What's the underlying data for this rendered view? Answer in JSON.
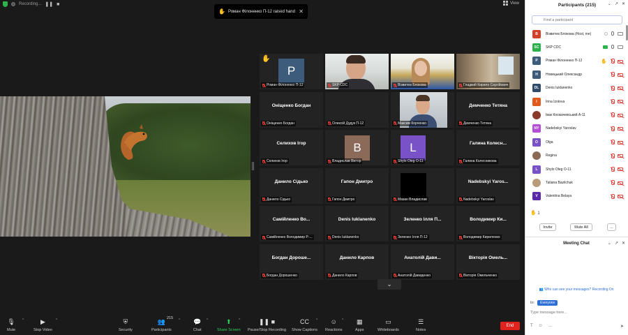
{
  "topbar": {
    "recording_label": "Recording...",
    "view_label": "View"
  },
  "notification": {
    "text": "Роман Філоненко П-12 raised hand"
  },
  "gallery": {
    "tiles": [
      {
        "label": "Роман Філоненко П-12",
        "avatar": "P",
        "avatar_color": "#3d5b7a",
        "hand": true
      },
      {
        "label": "SKP CDC",
        "video": "man-room",
        "highlight": true
      },
      {
        "label": "Візвитев Блокова",
        "video": "woman-flag"
      },
      {
        "label": "Гладкий Кирило Сергійович",
        "video": "room"
      },
      {
        "label": "Оніщенко Богдан",
        "center": "Оніщенко Богдан"
      },
      {
        "label": "Олексій Дудук П-12",
        "center": ""
      },
      {
        "label": "Максим Корченко",
        "video": "man-close"
      },
      {
        "label": "Демченко Тетяна",
        "center": "Демченко Тетяна"
      },
      {
        "label": "Селихов Ігор",
        "center": "Селихов Ігор"
      },
      {
        "label": "Владислав Віктор",
        "avatar": "B",
        "avatar_color": "#8c6a5a"
      },
      {
        "label": "Shylo Oleg О-11",
        "avatar": "L",
        "avatar_color": "#7a52c7"
      },
      {
        "label": "Галина Колесникова",
        "center": "Галина Колесн..."
      },
      {
        "label": "Данило Сідько",
        "center": "Данило Сідько"
      },
      {
        "label": "Гапон Дмитро",
        "center": "Гапон Дмитро"
      },
      {
        "label": "Мазан Владислав",
        "video": "black"
      },
      {
        "label": "Nadebskyi Yaroslav",
        "center": "Nadebskyi Yaros..."
      },
      {
        "label": "Самійленко Володимир Р-...",
        "center": "Самійленко Во..."
      },
      {
        "label": "Denis Iuklanenko",
        "center": "Denis Iuklanenko"
      },
      {
        "label": "Зеленко Ілля П-12",
        "center": "Зеленко Ілля П..."
      },
      {
        "label": "Володимир Кириленко",
        "center": "Володимир Ки..."
      },
      {
        "label": "Богдан Дорошенко",
        "center": "Богдан Дороше..."
      },
      {
        "label": "Данило Карпов",
        "center": "Данило Карпов"
      },
      {
        "label": "Анатолій Давиденко",
        "center": "Анатолій Дави..."
      },
      {
        "label": "Вікторія Омельченко",
        "center": "Вікторія Омель..."
      }
    ]
  },
  "toolbar": {
    "mute": "Mute",
    "stop_video": "Stop Video",
    "security": "Security",
    "participants": "Participants",
    "participants_count": "215",
    "chat": "Chat",
    "share_screen": "Share Screen",
    "pause_recording": "Pause/Stop Recording",
    "captions": "Show Captions",
    "reactions": "Reactions",
    "apps": "Apps",
    "whiteboards": "Whiteboards",
    "notes": "Notes",
    "end": "End"
  },
  "participants_panel": {
    "title": "Participants (215)",
    "search_placeholder": "Find a participant",
    "items": [
      {
        "name": "Візвитев Блокова (Host, me)",
        "initials": "B",
        "color": "#d0402a",
        "state": "host"
      },
      {
        "name": "SKP CDC",
        "initials": "SC",
        "color": "#2bb24c",
        "state": "video"
      },
      {
        "name": "Роман Філоненко П-12",
        "initials": "P",
        "color": "#3d5b7a",
        "state": "hand"
      },
      {
        "name": "Новицький Олександр",
        "initials": "Н",
        "color": "#3d5b7a",
        "state": "off"
      },
      {
        "name": "Denis Iuklanenko",
        "initials": "DL",
        "color": "#2f4a6a",
        "state": "off"
      },
      {
        "name": "Irina Izotova",
        "initials": "I",
        "color": "#e05a1e",
        "state": "off"
      },
      {
        "name": "Ївак Космачевський А-11",
        "initials": "",
        "color": "#8a3a2a",
        "state": "off"
      },
      {
        "name": "Nadebskyi Yaroslav",
        "initials": "NY",
        "color": "#b34fd6",
        "state": "off"
      },
      {
        "name": "Olga",
        "initials": "O",
        "color": "#7a52c7",
        "state": "off"
      },
      {
        "name": "Regina",
        "initials": "",
        "color": "#8a6a52",
        "state": "off"
      },
      {
        "name": "Shylo Oleg О-11",
        "initials": "L",
        "color": "#7a52c7",
        "state": "off"
      },
      {
        "name": "Tatiana Bazilchuk",
        "initials": "",
        "color": "#b99a7a",
        "state": "off"
      },
      {
        "name": "Valentina Belaya",
        "initials": "V",
        "color": "#5a2aa8",
        "state": "off"
      }
    ],
    "raised_hands": "1",
    "invite_label": "Invite",
    "mute_all_label": "Mute All",
    "more_label": "..."
  },
  "chat": {
    "title": "Meeting Chat",
    "notice": "Who can see your messages? Recording On",
    "to_label": "to:",
    "recipient": "Everyone",
    "input_placeholder": "Type message here..."
  }
}
